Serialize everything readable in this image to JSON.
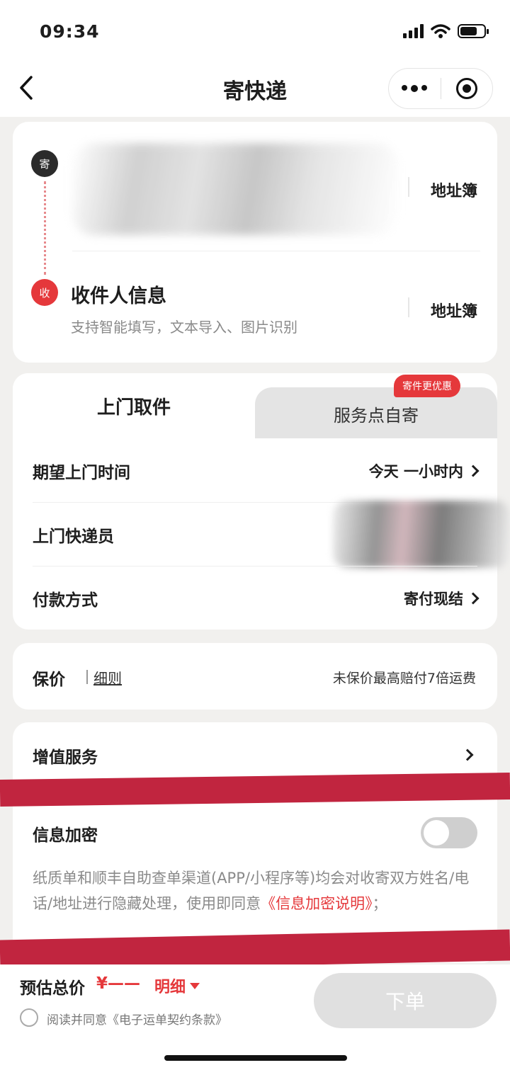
{
  "status_bar": {
    "time": "09:34"
  },
  "nav": {
    "title": "寄快递"
  },
  "address": {
    "sender_badge": "寄",
    "receiver_badge": "收",
    "address_book": "地址簿",
    "receiver_title": "收件人信息",
    "receiver_hint": "支持智能填写，文本导入、图片识别"
  },
  "tabs": {
    "pickup": "上门取件",
    "dropoff": "服务点自寄",
    "promo": "寄件更优惠"
  },
  "pickup": {
    "time_label": "期望上门时间",
    "time_value": "今天 一小时内",
    "courier_label": "上门快递员",
    "payment_label": "付款方式",
    "payment_value": "寄付现结"
  },
  "insurance": {
    "label": "保价",
    "link": "细则",
    "note": "未保价最高赔付7倍运费"
  },
  "value_added": {
    "title": "增值服务",
    "encryption_title": "信息加密",
    "encryption_on": false,
    "encryption_text": "纸质单和顺丰自助查单渠道(APP/小程序等)均会对收寄双方姓名/电话/地址进行隐藏处理，使用即同意",
    "encryption_link": "《信息加密说明》",
    "encryption_tail": "；"
  },
  "bottom": {
    "total_label": "预估总价",
    "total_price": "¥——",
    "detail": "明细",
    "agree_text": "阅读并同意《电子运单契约条款》",
    "submit": "下单"
  },
  "colors": {
    "accent": "#e5383b",
    "background": "#f1f0ee"
  }
}
